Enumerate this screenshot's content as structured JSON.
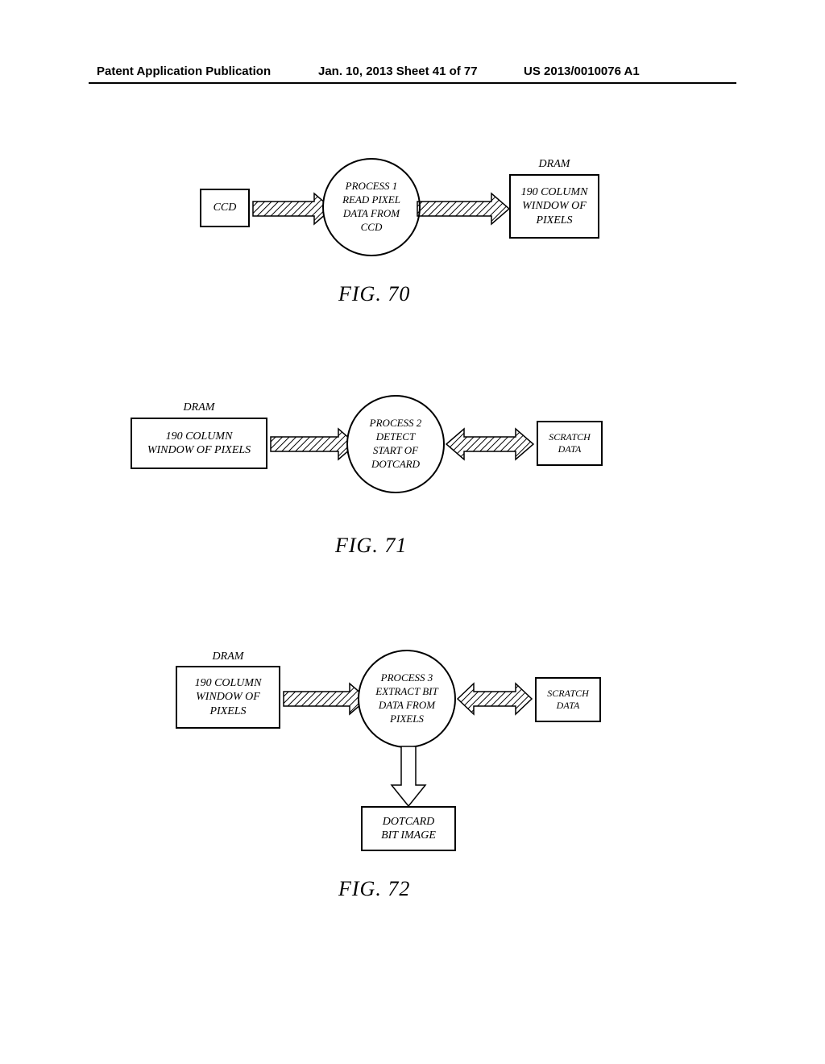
{
  "header": {
    "left": "Patent Application Publication",
    "center": "Jan. 10, 2013  Sheet 41 of 77",
    "right": "US 2013/0010076 A1"
  },
  "fig70": {
    "caption": "FIG. 70",
    "left_box": "CCD",
    "circle": "PROCESS 1\nREAD PIXEL\nDATA FROM\nCCD",
    "right_box_title": "DRAM",
    "right_box": "190 COLUMN\nWINDOW OF\nPIXELS"
  },
  "fig71": {
    "caption": "FIG. 71",
    "left_box_title": "DRAM",
    "left_box": "190 COLUMN\nWINDOW OF PIXELS",
    "circle": "PROCESS 2\nDETECT\nSTART OF\nDOTCARD",
    "right_box": "SCRATCH\nDATA"
  },
  "fig72": {
    "caption": "FIG. 72",
    "left_box_title": "DRAM",
    "left_box": "190 COLUMN\nWINDOW OF\nPIXELS",
    "circle": "PROCESS 3\nEXTRACT BIT\nDATA FROM\nPIXELS",
    "right_box": "SCRATCH\nDATA",
    "bottom_box": "DOTCARD\nBIT IMAGE"
  }
}
